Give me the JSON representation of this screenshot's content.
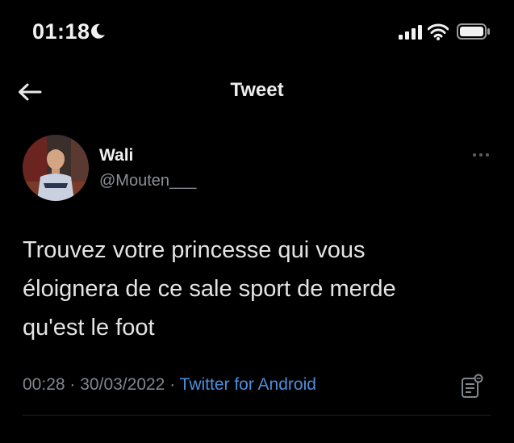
{
  "status_bar": {
    "time": "01:18",
    "icons": [
      "moon-icon",
      "cellular-signal-icon",
      "wifi-icon",
      "battery-icon"
    ]
  },
  "nav": {
    "back_icon": "arrow-left-icon",
    "title": "Tweet"
  },
  "tweet": {
    "author_name": "Wali",
    "author_handle": "@Mouten___",
    "text_lines": [
      "Trouvez votre princesse qui vous",
      "éloignera de ce sale sport de merde",
      "qu'est le foot"
    ],
    "time": "00:28",
    "separator": "·",
    "date": "30/03/2022",
    "source": "Twitter for Android",
    "icons": [
      "avatar-photo",
      "more-dots-icon",
      "analytics-note-icon"
    ]
  },
  "colors": {
    "background": "#000000",
    "text_primary": "#e7e9ea",
    "text_secondary": "#80868c",
    "link": "#4c8fdc"
  }
}
